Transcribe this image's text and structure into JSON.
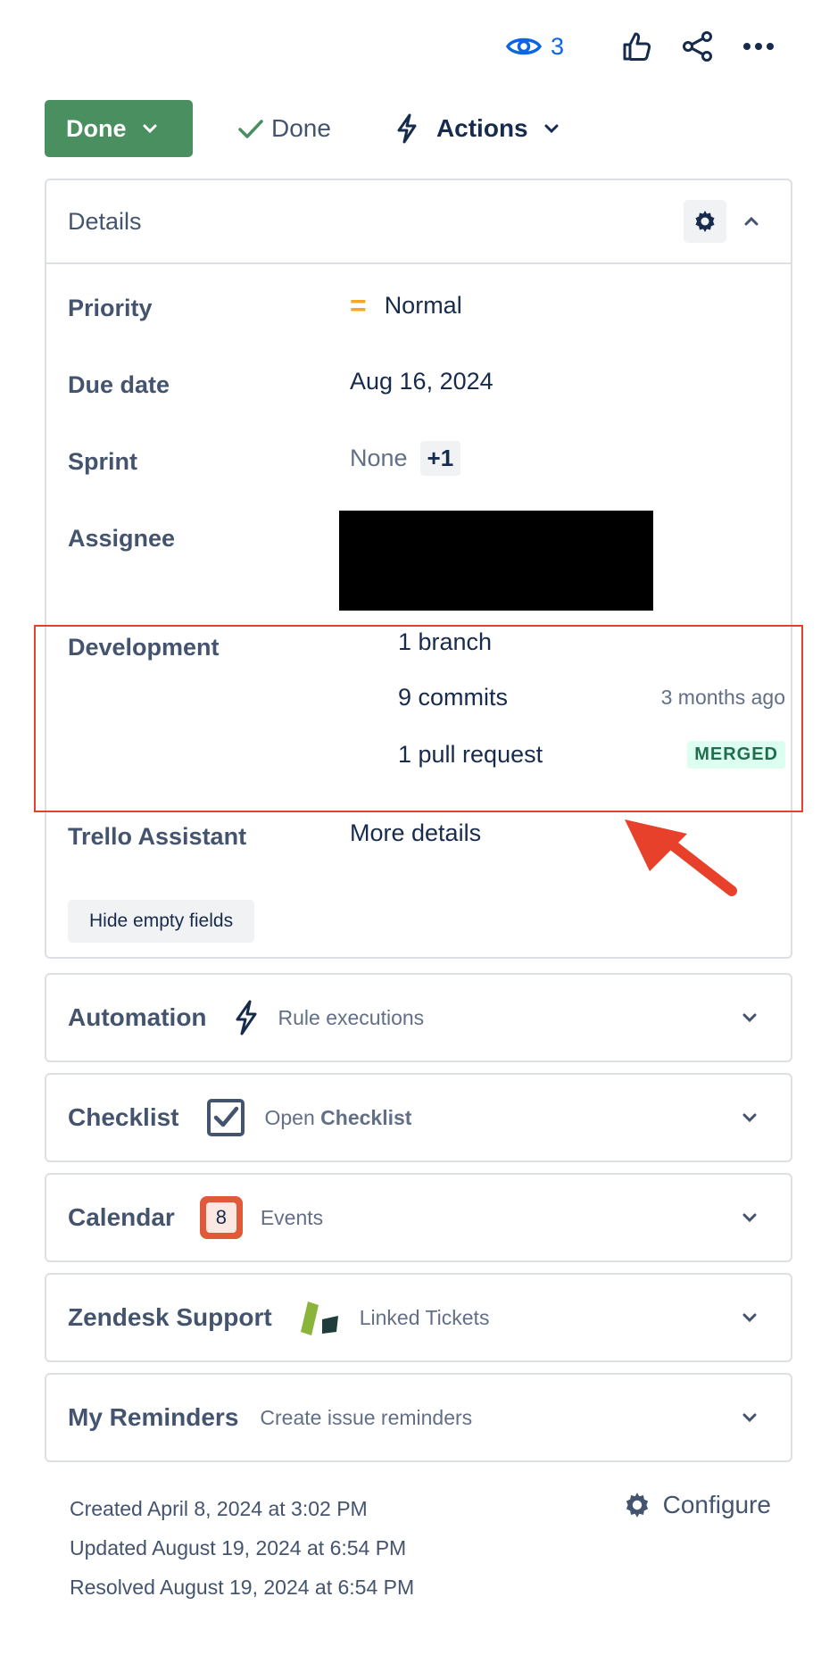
{
  "header": {
    "watch_count": "3"
  },
  "toolbar": {
    "status_label": "Done",
    "resolution_label": "Done",
    "actions_label": "Actions"
  },
  "details": {
    "title": "Details",
    "fields": {
      "priority": {
        "label": "Priority",
        "value": "Normal"
      },
      "due_date": {
        "label": "Due date",
        "value": "Aug 16, 2024"
      },
      "sprint": {
        "label": "Sprint",
        "value": "None",
        "extra": "+1"
      },
      "assignee": {
        "label": "Assignee"
      },
      "development": {
        "label": "Development",
        "branch": "1 branch",
        "commits": "9 commits",
        "commits_time": "3 months ago",
        "pull_request": "1 pull request",
        "pr_status": "MERGED"
      },
      "trello": {
        "label": "Trello Assistant",
        "value": "More details"
      }
    },
    "hide_empty_label": "Hide empty fields"
  },
  "glances": [
    {
      "title": "Automation",
      "subtitle": "Rule executions",
      "icon": "lightning-icon"
    },
    {
      "title": "Checklist",
      "subtitle_prefix": "Open ",
      "subtitle_bold": "Checklist",
      "icon": "checkbox-icon"
    },
    {
      "title": "Calendar",
      "subtitle": "Events",
      "icon": "calendar-icon",
      "icon_text": "8"
    },
    {
      "title": "Zendesk Support",
      "subtitle": "Linked Tickets",
      "icon": "zendesk-icon"
    },
    {
      "title": "My Reminders",
      "subtitle": "Create issue reminders"
    }
  ],
  "footer": {
    "created": "Created April 8, 2024 at 3:02 PM",
    "updated": "Updated August 19, 2024 at 6:54 PM",
    "resolved": "Resolved August 19, 2024 at 6:54 PM",
    "configure_label": "Configure"
  },
  "colors": {
    "status_done": "#4a8f5f",
    "accent_blue": "#0c66e4",
    "highlight_red": "#e8412b",
    "merged_bg": "#dcfff1",
    "merged_text": "#216e4e"
  }
}
